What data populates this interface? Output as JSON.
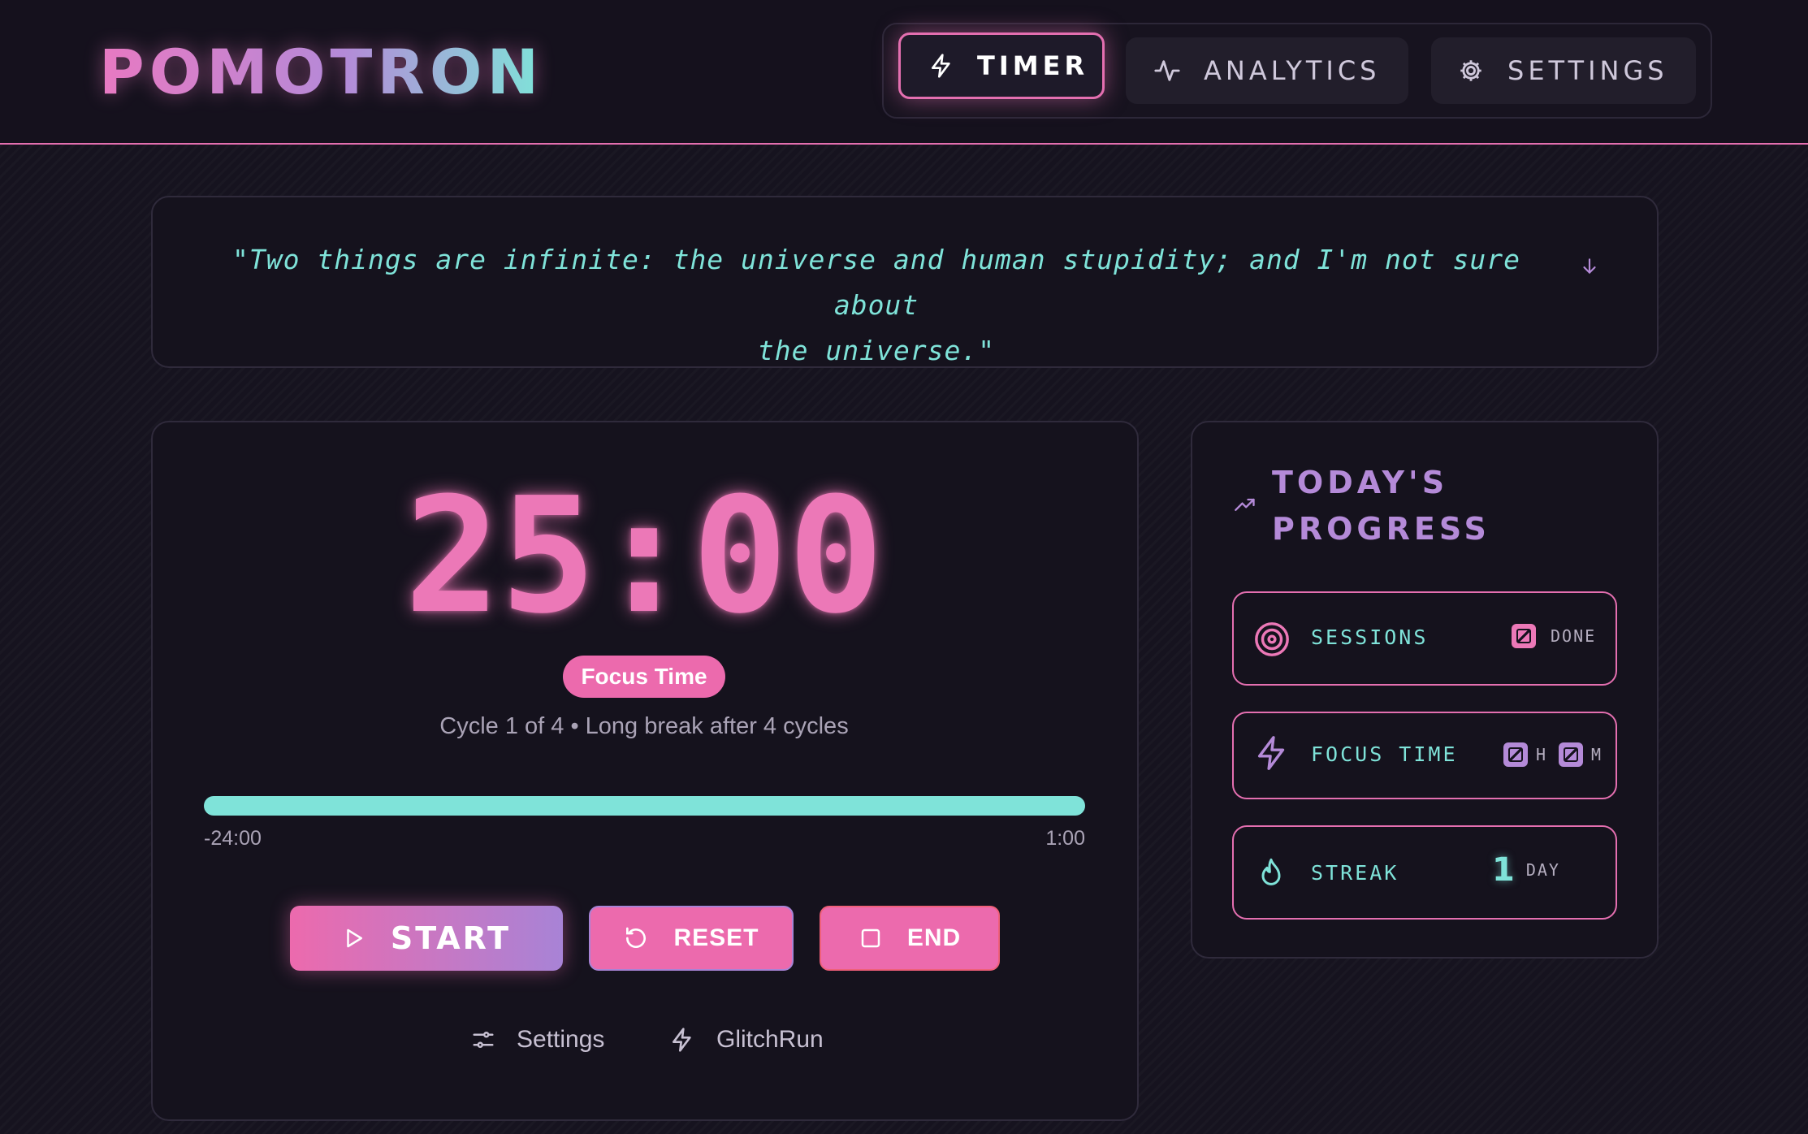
{
  "app": {
    "logo": "POMOTRON"
  },
  "nav": {
    "tabs": [
      {
        "label": "TIMER",
        "icon": "bolt-icon",
        "active": true
      },
      {
        "label": "ANALYTICS",
        "icon": "activity-icon",
        "active": false
      },
      {
        "label": "SETTINGS",
        "icon": "gear-icon",
        "active": false
      }
    ]
  },
  "quote": {
    "line1": "\"Two things are infinite: the universe and human stupidity; and I'm not sure about",
    "line2": "the universe.\"",
    "toggle_icon": "arrow-down-icon"
  },
  "timer": {
    "display": "25:00",
    "mode": "Focus Time",
    "cycle_text": "Cycle 1 of 4 • Long break after 4 cycles",
    "progress_fraction": 1.0,
    "elapsed_label": "-24:00",
    "total_label": "1:00"
  },
  "controls": {
    "start_label": "START",
    "reset_label": "RESET",
    "end_label": "END"
  },
  "links": {
    "settings_label": "Settings",
    "glitchrun_label": "GlitchRun"
  },
  "progress": {
    "title_line1": "TODAY'S",
    "title_line2": "PROGRESS",
    "sessions_label": "SESSIONS",
    "sessions_unit": "DONE",
    "focus_label": "FOCUS TIME",
    "focus_hours_unit": "H",
    "focus_minutes_unit": "M",
    "streak_label": "STREAK",
    "streak_value": "1",
    "streak_unit": "DAY"
  },
  "colors": {
    "accent_pink": "#ec78b7",
    "accent_cyan": "#7fe3d9",
    "accent_purple": "#b48ad8",
    "background": "#16131f"
  }
}
